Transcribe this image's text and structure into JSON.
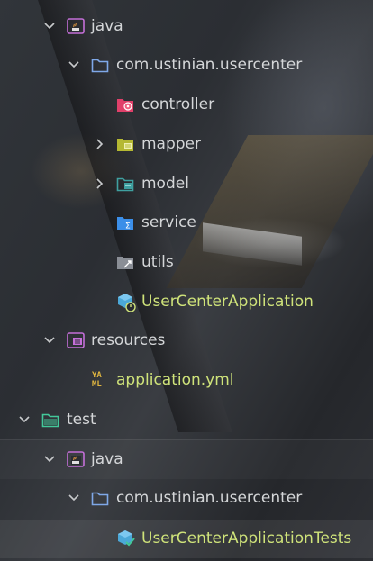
{
  "tree": {
    "items": [
      {
        "label": "java",
        "icon": "java-source-folder-icon",
        "expanded": true
      },
      {
        "label": "com.ustinian.usercenter",
        "icon": "package-folder-icon",
        "expanded": true
      },
      {
        "label": "controller",
        "icon": "controller-folder-icon"
      },
      {
        "label": "mapper",
        "icon": "mapper-folder-icon",
        "expanded": false
      },
      {
        "label": "model",
        "icon": "model-folder-icon",
        "expanded": false
      },
      {
        "label": "service",
        "icon": "service-folder-icon"
      },
      {
        "label": "utils",
        "icon": "utils-folder-icon"
      },
      {
        "label": "UserCenterApplication",
        "icon": "spring-app-class-icon"
      },
      {
        "label": "resources",
        "icon": "resources-folder-icon",
        "expanded": true
      },
      {
        "label": "application.yml",
        "icon": "yaml-file-icon",
        "icon_text": "YA\nML"
      },
      {
        "label": "test",
        "icon": "test-folder-icon",
        "expanded": true
      },
      {
        "label": "java",
        "icon": "java-test-folder-icon",
        "expanded": true
      },
      {
        "label": "com.ustinian.usercenter",
        "icon": "package-folder-icon",
        "expanded": true
      },
      {
        "label": "UserCenterApplicationTests",
        "icon": "spring-test-class-icon"
      }
    ]
  },
  "colors": {
    "text": "#d4d6d8",
    "app_class_text": "#cfe37a",
    "java_folder": "#c46fd8",
    "package_folder": "#7fa8e8",
    "controller": "#e0406a",
    "mapper": "#b5b832",
    "model": "#3fa0a0",
    "service": "#3b8ee8",
    "test_folder": "#43c89a"
  }
}
